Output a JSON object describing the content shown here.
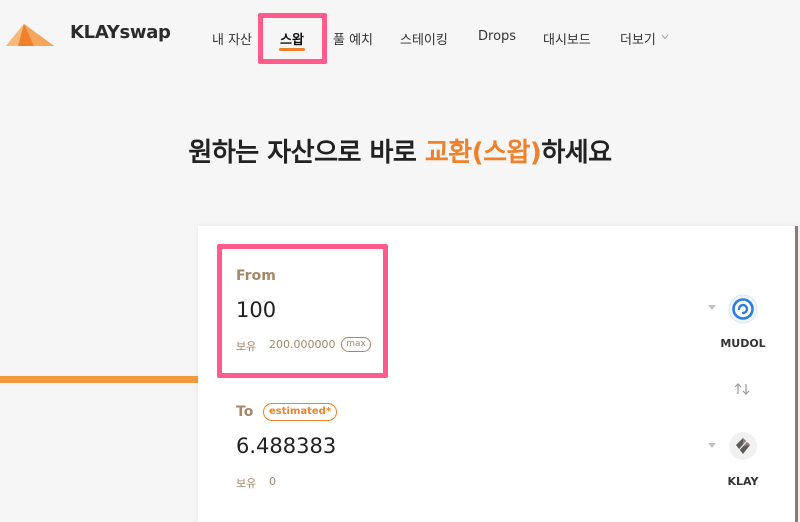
{
  "brand": {
    "name": "KLAYswap",
    "accent": "#f0812a",
    "highlight": "#ff5c8d"
  },
  "nav": {
    "items": [
      {
        "label": "내 자산"
      },
      {
        "label": "스왑",
        "active": true
      },
      {
        "label": "풀 예치"
      },
      {
        "label": "스테이킹"
      },
      {
        "label": "Drops"
      },
      {
        "label": "대시보드"
      },
      {
        "label": "더보기"
      }
    ]
  },
  "headline": {
    "before": "원하는 자산으로 바로 ",
    "accent": "교환(스왑)",
    "after": "하세요"
  },
  "swap": {
    "from": {
      "label": "From",
      "amount": "100",
      "balance_label": "보유",
      "balance_value": "200.000000",
      "max_label": "max",
      "token": "MUDOL",
      "token_icon": "mudol-swirl-icon"
    },
    "to": {
      "label": "To",
      "badge": "estimated*",
      "amount": "6.488383",
      "balance_label": "보유",
      "balance_value": "0",
      "token": "KLAY",
      "token_icon": "klay-token-icon"
    },
    "switch_icon": "swap-arrows-icon"
  }
}
